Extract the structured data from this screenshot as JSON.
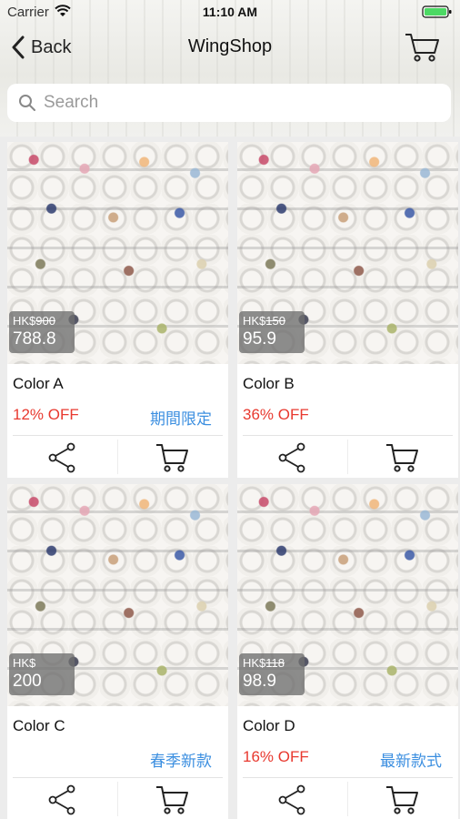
{
  "status_bar": {
    "carrier": "Carrier",
    "time": "11:10 AM"
  },
  "nav": {
    "back_label": "Back",
    "title": "WingShop"
  },
  "search": {
    "placeholder": "Search"
  },
  "colors": {
    "discount": "#e8392f",
    "tag": "#3c8fe0",
    "background": "#ececec"
  },
  "products": [
    {
      "name": "Color A",
      "currency": "HK$",
      "original_price": "900",
      "price": "788.8",
      "discount": "12% OFF",
      "tag": "期間限定"
    },
    {
      "name": "Color B",
      "currency": "HK$",
      "original_price": "150",
      "price": "95.9",
      "discount": "36% OFF",
      "tag": ""
    },
    {
      "name": "Color C",
      "currency": "HK$",
      "original_price": "",
      "price": "200",
      "discount": "",
      "tag": "春季新款"
    },
    {
      "name": "Color D",
      "currency": "HK$",
      "original_price": "118",
      "price": "98.9",
      "discount": "16% OFF",
      "tag": "最新款式"
    }
  ],
  "icons": {
    "share": "share-icon",
    "cart": "cart-icon",
    "back": "chevron-left-icon",
    "search": "search-icon"
  }
}
